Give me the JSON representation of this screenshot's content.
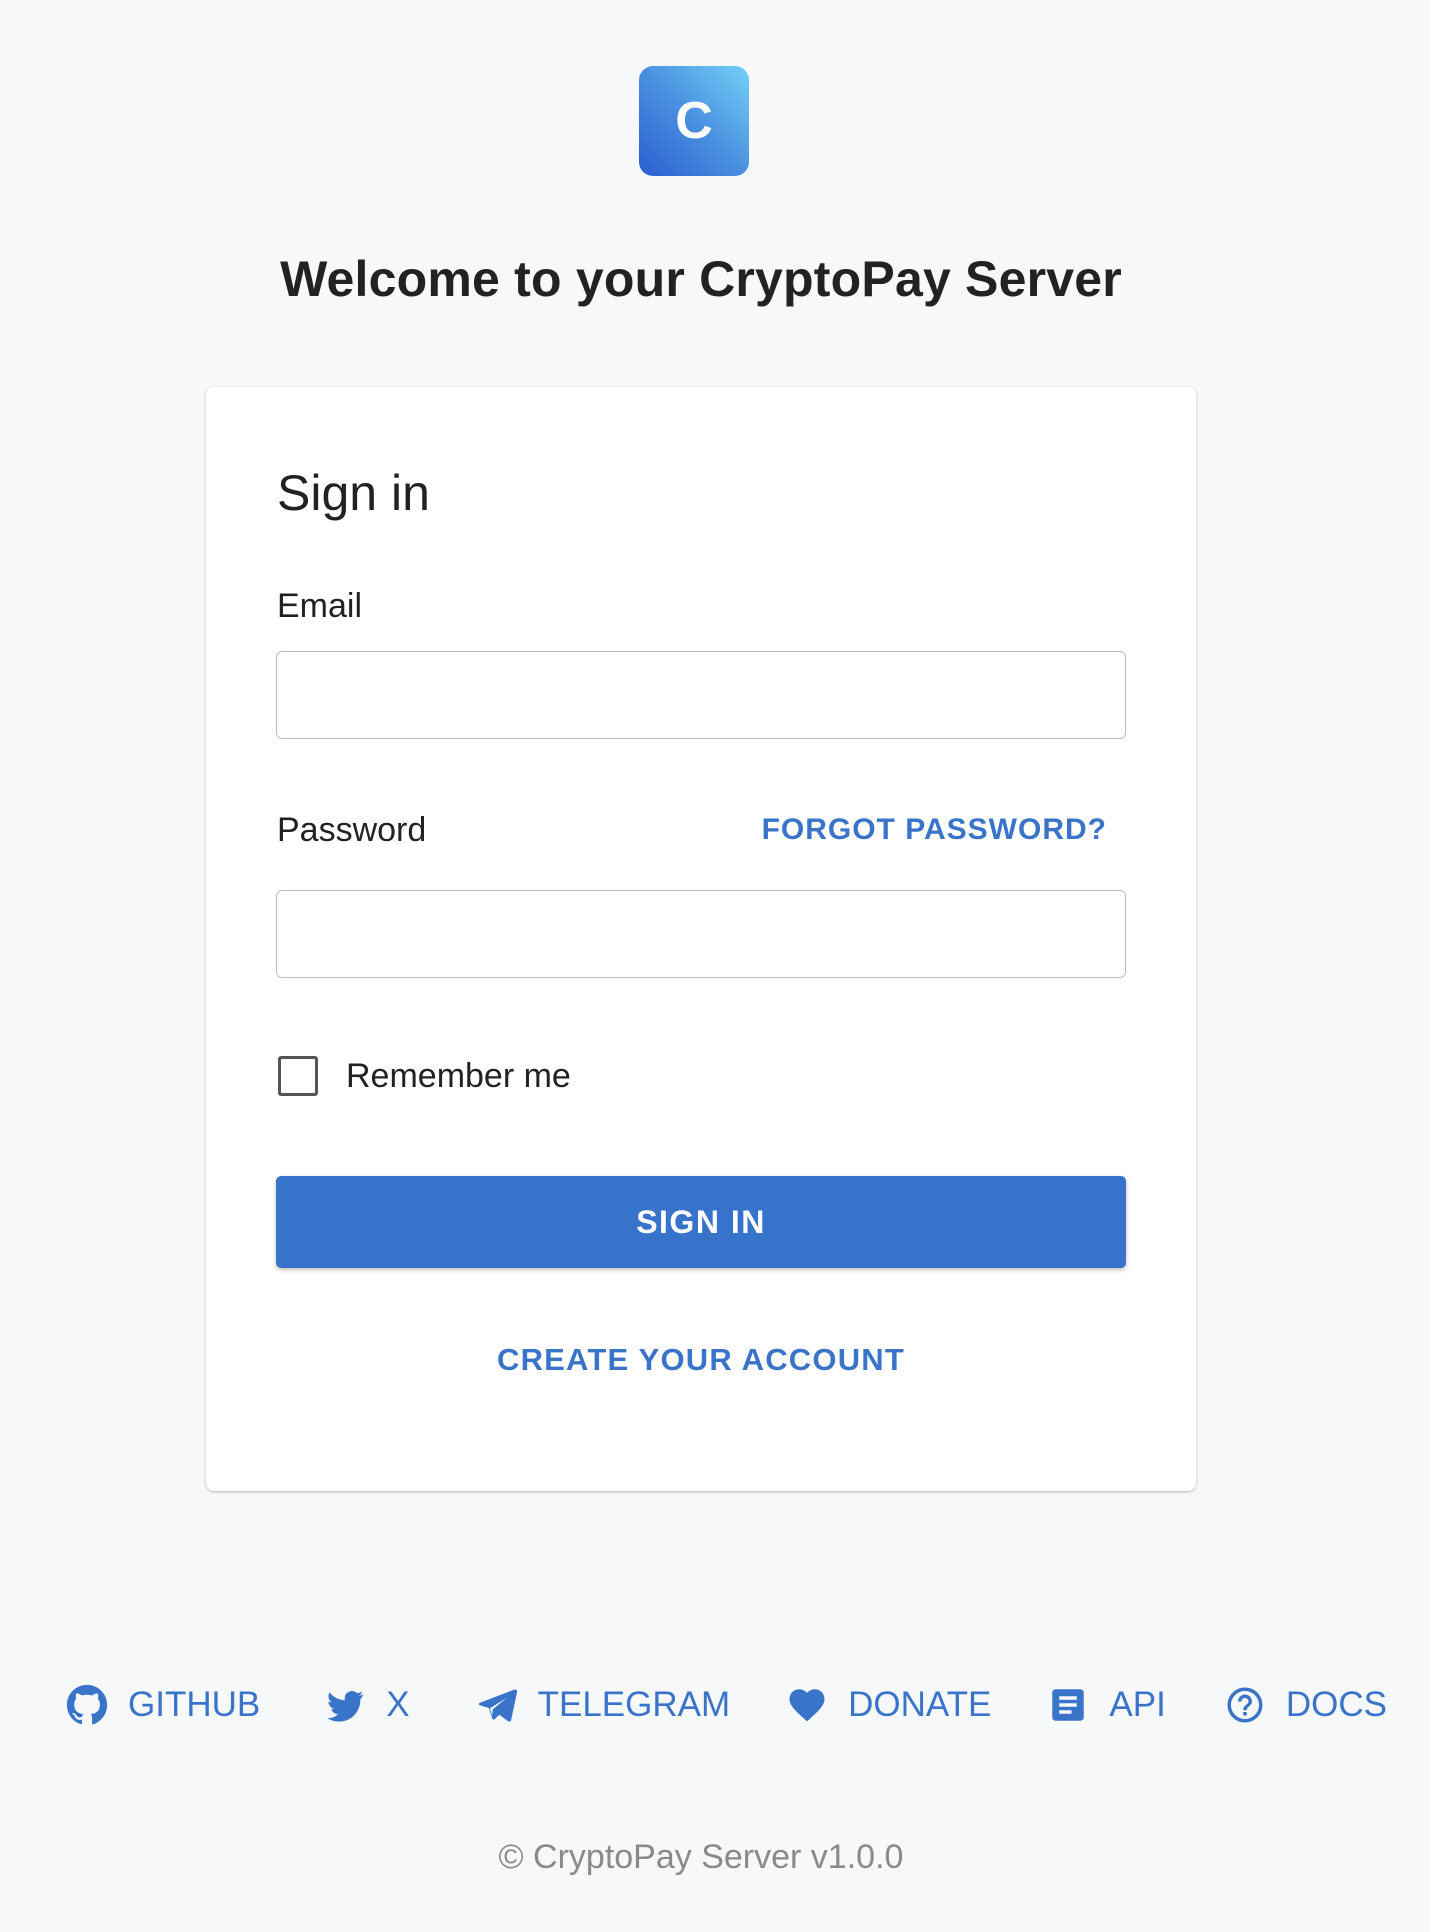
{
  "header": {
    "logo_letter": "C",
    "welcome_title": "Welcome to your CryptoPay Server"
  },
  "signin_card": {
    "title": "Sign in",
    "email_label": "Email",
    "email_value": "",
    "password_label": "Password",
    "password_value": "",
    "forgot_password": "FORGOT PASSWORD?",
    "remember_me": "Remember me",
    "remember_checked": false,
    "signin_button": "SIGN IN",
    "create_account": "CREATE YOUR ACCOUNT"
  },
  "footer": {
    "links": [
      {
        "label": "GITHUB",
        "icon": "github-icon"
      },
      {
        "label": "X",
        "icon": "twitter-bird-icon"
      },
      {
        "label": "TELEGRAM",
        "icon": "paper-plane-icon"
      },
      {
        "label": "DONATE",
        "icon": "heart-icon"
      },
      {
        "label": "API",
        "icon": "document-icon"
      },
      {
        "label": "DOCS",
        "icon": "help-circle-icon"
      }
    ],
    "copyright": "© CryptoPay Server v1.0.0"
  },
  "colors": {
    "accent": "#3873cb",
    "link": "#3a74c9",
    "background": "#f7f8fa",
    "card": "#ffffff",
    "muted_text": "#8a8a8a"
  }
}
